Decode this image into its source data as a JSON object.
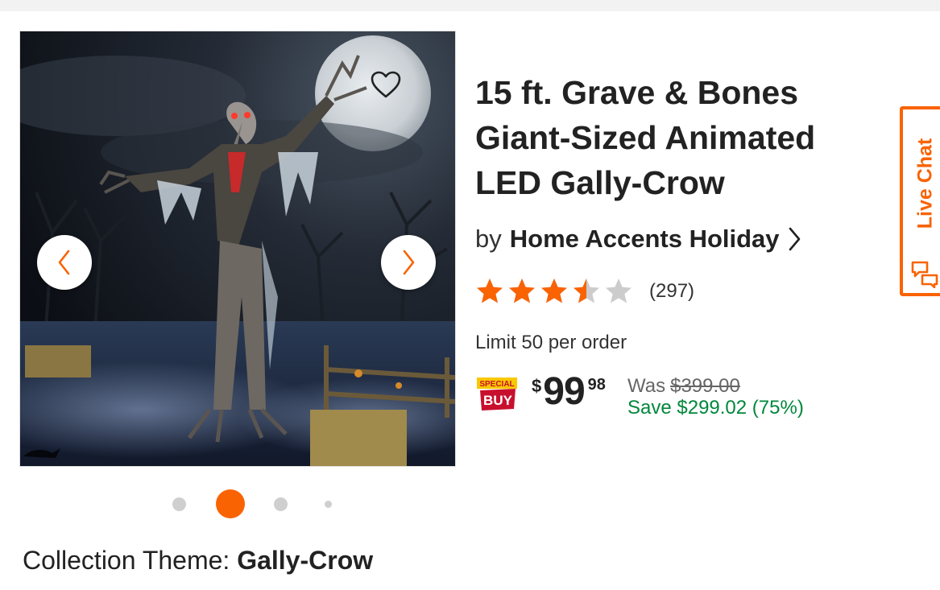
{
  "product": {
    "title": "15 ft. Grave & Bones Giant-Sized Animated LED Gally-Crow",
    "by_label": "by",
    "brand": "Home Accents Holiday",
    "rating": 3.5,
    "rating_max": 5,
    "review_count": "(297)",
    "limit_text": "Limit 50 per order",
    "badge": {
      "line1": "SPECIAL",
      "line2": "BUY"
    },
    "price": {
      "currency": "$",
      "dollars": "99",
      "cents": "98"
    },
    "was_label": "Was",
    "was_price": "$399.00",
    "save_text": "Save $299.02 (75%)"
  },
  "carousel": {
    "image_count": 4,
    "active_index": 1,
    "icons": {
      "favorite": "heart-icon",
      "prev": "chevron-left-icon",
      "next": "chevron-right-icon"
    }
  },
  "collection": {
    "label": "Collection Theme:",
    "value": "Gally-Crow"
  },
  "live_chat": {
    "label": "Live Chat",
    "icon": "chat-bubbles-icon"
  },
  "colors": {
    "accent": "#f96302",
    "star": "#f96302",
    "star_empty": "#cccccc",
    "save_green": "#00873c"
  }
}
